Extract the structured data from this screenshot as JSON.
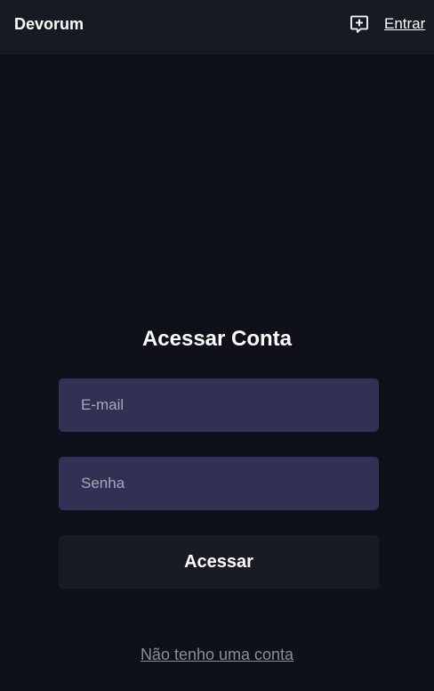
{
  "header": {
    "brand": "Devorum",
    "new_post_icon": "message-plus-icon",
    "login_label": "Entrar"
  },
  "login_form": {
    "title": "Acessar Conta",
    "email_placeholder": "E-mail",
    "email_value": "",
    "password_placeholder": "Senha",
    "password_value": "",
    "submit_label": "Acessar",
    "register_link": "Não tenho uma conta"
  },
  "colors": {
    "page_background": "#0e111a",
    "header_background": "#161a22",
    "input_background": "#333153",
    "button_background": "#181b23",
    "link_muted": "#8a8d99"
  }
}
